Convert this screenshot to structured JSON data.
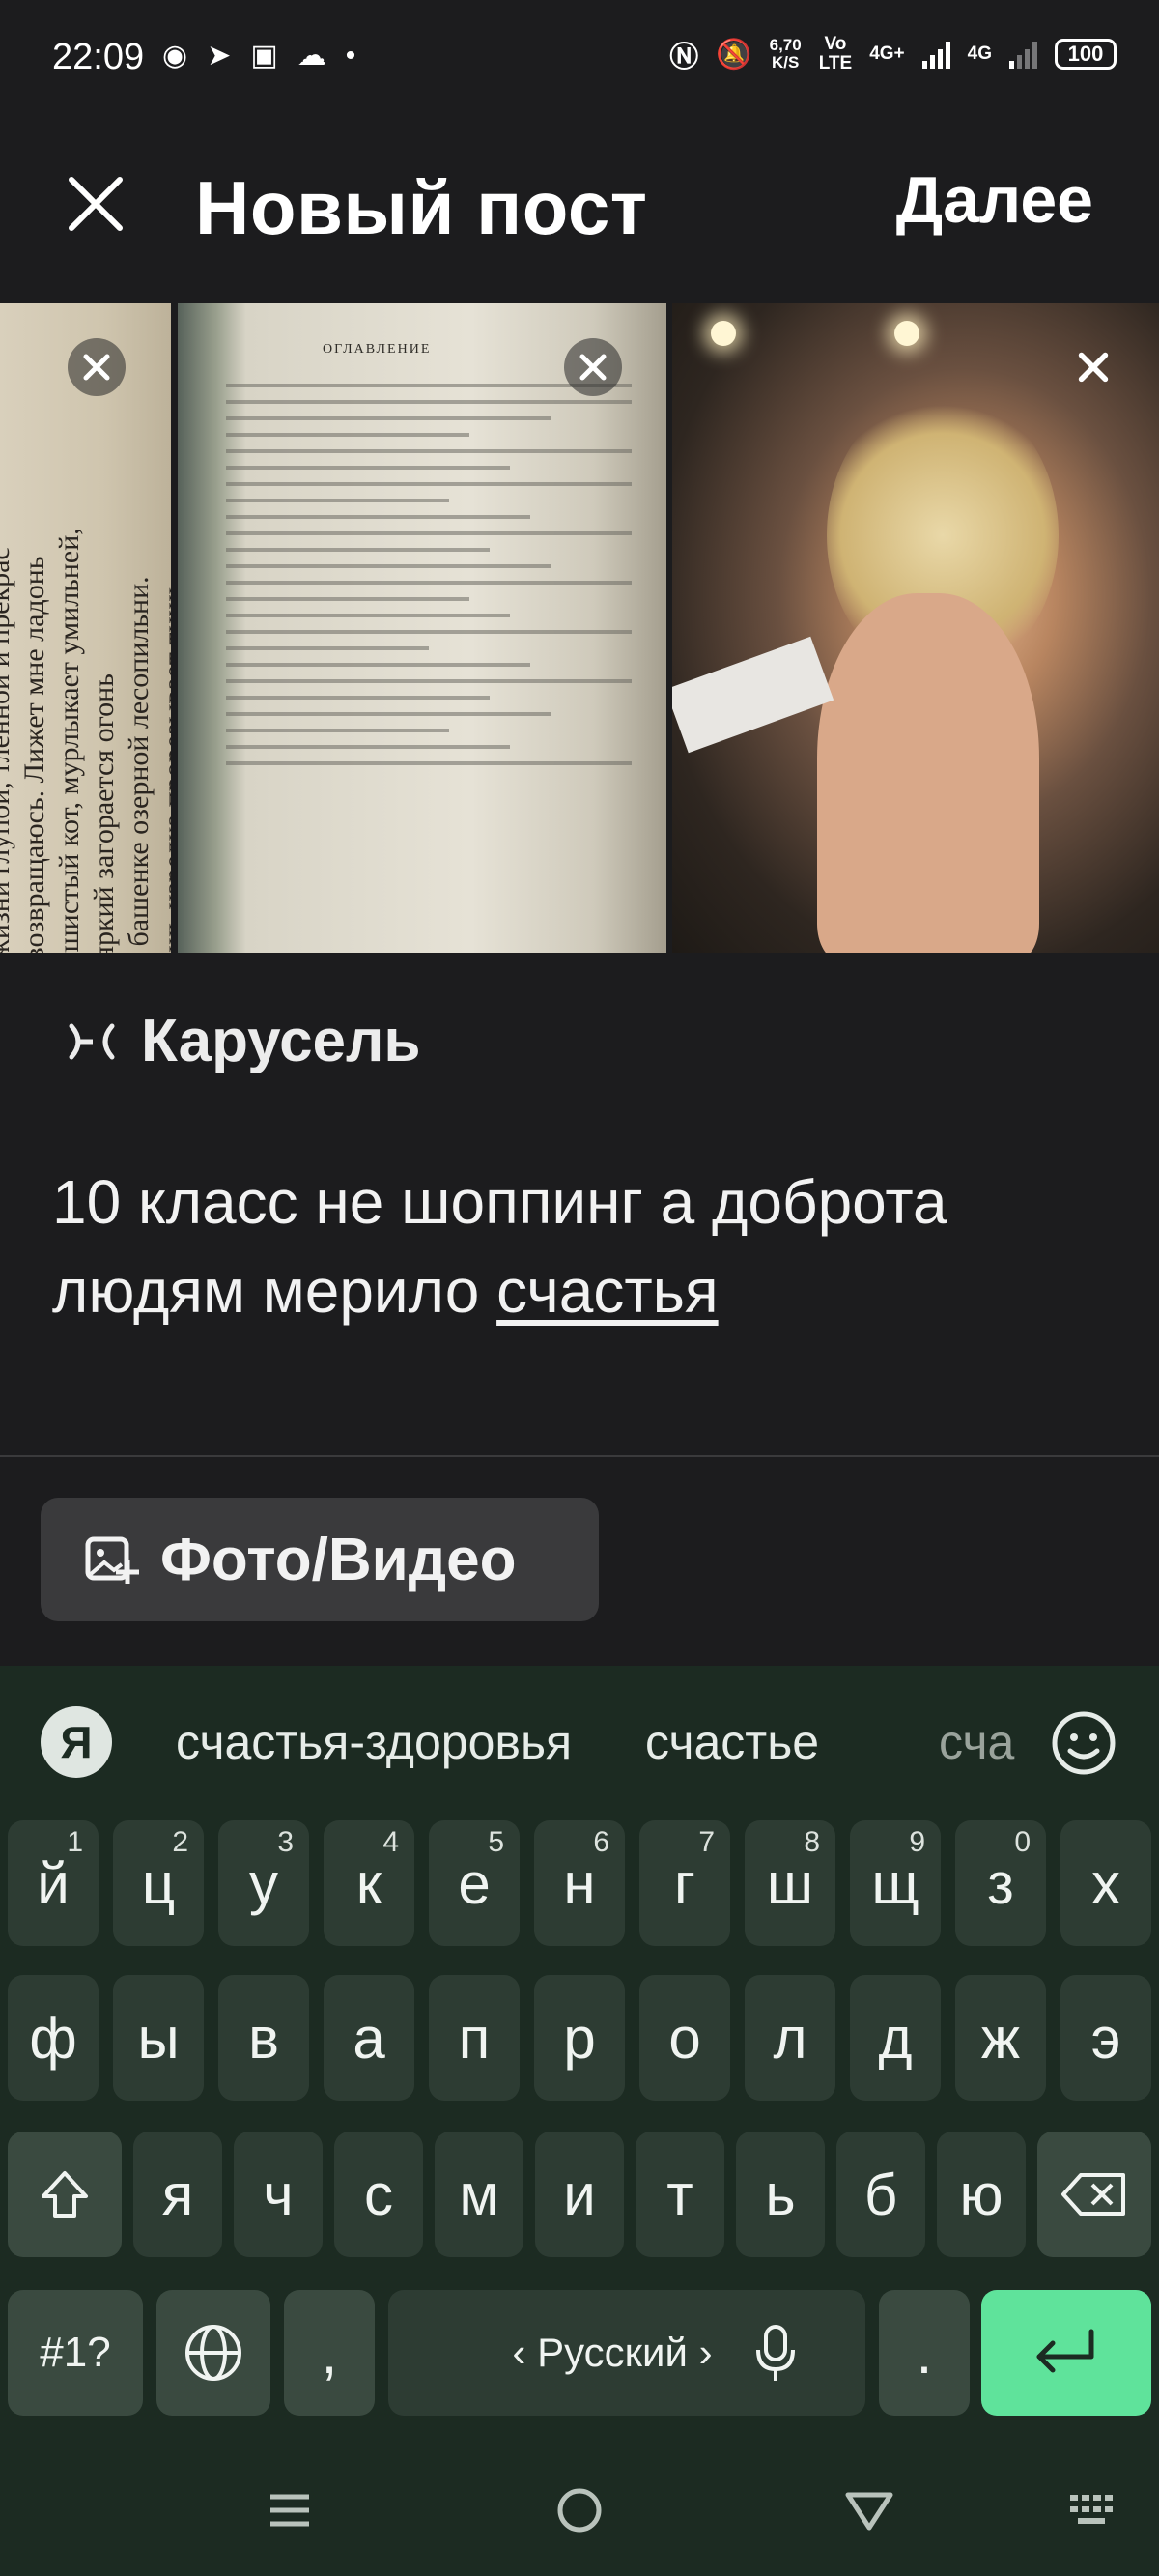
{
  "status_bar": {
    "time": "22:09",
    "speed_value": "6,70",
    "speed_unit": "K/S",
    "volte_top": "Vo",
    "volte_bottom": "LTE",
    "net1": "4G+",
    "net2": "4G",
    "battery": "100"
  },
  "header": {
    "title": "Новый пост",
    "next_label": "Далее"
  },
  "thumbnails": [
    {
      "lines": [
        "О жизни глупой, тленной и прекрас",
        "Я возвращаюсь. Лижет мне ладонь",
        "Пушистый кот, мурлыкает умильней,",
        "И яркий загорается огонь",
        "На башенке озерной лесопильни.",
        "Лишь изредка прорезывает тишь"
      ]
    },
    {
      "heading": "ОГЛАВЛЕНИЕ"
    },
    {}
  ],
  "carousel": {
    "label": "Карусель"
  },
  "post": {
    "text_main": "10 класс не шоппинг а доброта людям мерило ",
    "text_underlined": "счастья"
  },
  "media_button": {
    "label": "Фото/Видео"
  },
  "keyboard": {
    "logo": "Я",
    "suggestions": [
      "счастья-здоровья",
      "счастье",
      "сча"
    ],
    "row1": [
      {
        "k": "й",
        "n": "1"
      },
      {
        "k": "ц",
        "n": "2"
      },
      {
        "k": "у",
        "n": "3"
      },
      {
        "k": "к",
        "n": "4"
      },
      {
        "k": "е",
        "n": "5"
      },
      {
        "k": "н",
        "n": "6"
      },
      {
        "k": "г",
        "n": "7"
      },
      {
        "k": "ш",
        "n": "8"
      },
      {
        "k": "щ",
        "n": "9"
      },
      {
        "k": "з",
        "n": "0"
      },
      {
        "k": "х",
        "n": ""
      }
    ],
    "row2": [
      "ф",
      "ы",
      "в",
      "а",
      "п",
      "р",
      "о",
      "л",
      "д",
      "ж",
      "э"
    ],
    "row3": [
      "я",
      "ч",
      "с",
      "м",
      "и",
      "т",
      "ь",
      "б",
      "ю"
    ],
    "symbols_label": "#1?",
    "comma": ",",
    "space_label": "‹ Русский ›",
    "period": "."
  },
  "icons": [
    "close-icon",
    "carousel-icon",
    "photo-video-icon",
    "emoji-icon",
    "shift-icon",
    "backspace-icon",
    "globe-icon",
    "microphone-icon",
    "enter-icon",
    "menu-icon",
    "home-icon",
    "back-icon",
    "keyboard-icon"
  ],
  "colors": {
    "background": "#1c1c1e",
    "keyboard_bg": "#1c2b22",
    "key_bg": "#2d3c33",
    "enter_key": "#5fe39b",
    "button_bg": "#3a3a3c"
  }
}
